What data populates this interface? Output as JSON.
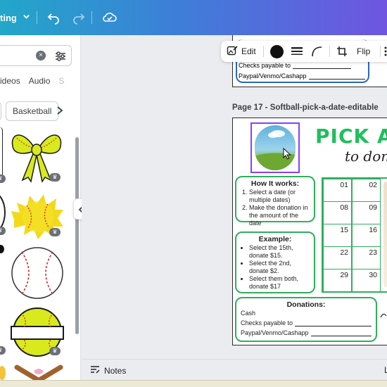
{
  "topbar": {
    "menu_label": "ting",
    "colors": {
      "accent_start": "#22a7c9",
      "accent_end": "#6f55e0"
    },
    "icons": [
      "chevron-down-icon",
      "undo-icon",
      "redo-icon",
      "cloud-save-icon"
    ]
  },
  "sidebar": {
    "tabs": [
      "ideos",
      "Audio",
      "S"
    ],
    "chips": [
      "Basketball"
    ],
    "icons": [
      "clear-search-icon",
      "filter-icon",
      "chevron-right-icon",
      "crown-icon"
    ]
  },
  "element_toolbar": {
    "edit_label": "Edit",
    "flip_label": "Flip",
    "color": "#111111",
    "icons": [
      "edit-image-icon",
      "color-swatch-icon",
      "border-style-icon",
      "corner-rounding-icon",
      "crop-icon",
      "more-icon"
    ]
  },
  "prev_page": {
    "checks_label": "Checks payable to",
    "paypal_label": "Paypal/Venmo/Cashapp"
  },
  "page": {
    "label": "Page 17 - Softball-pick-a-date-editable",
    "heading": "PICK A",
    "subheading": "to don",
    "how_title": "How It works:",
    "how_steps": [
      "Select a date (or multiple dates)",
      "Make the donation in the amount of the date"
    ],
    "example_title": "Example:",
    "example_items": [
      "Select the 15th, donate $15.",
      "Select the 2nd, donate $2.",
      "Select them both, donate $17"
    ],
    "donations_title": "Donations:",
    "cash_label": "Cash",
    "checks_label": "Checks payable to",
    "paypal_label": "Paypal/Venmo/Cashapp",
    "grid_numbers": [
      "01",
      "02",
      "08",
      "09",
      "15",
      "16",
      "22",
      "23",
      "29",
      "30"
    ],
    "colors": {
      "green": "#2fae5d",
      "title_green": "#1fbf5c",
      "selection": "#8a3ffc"
    }
  },
  "notes": {
    "label": "Notes",
    "icon": "notes-icon"
  }
}
